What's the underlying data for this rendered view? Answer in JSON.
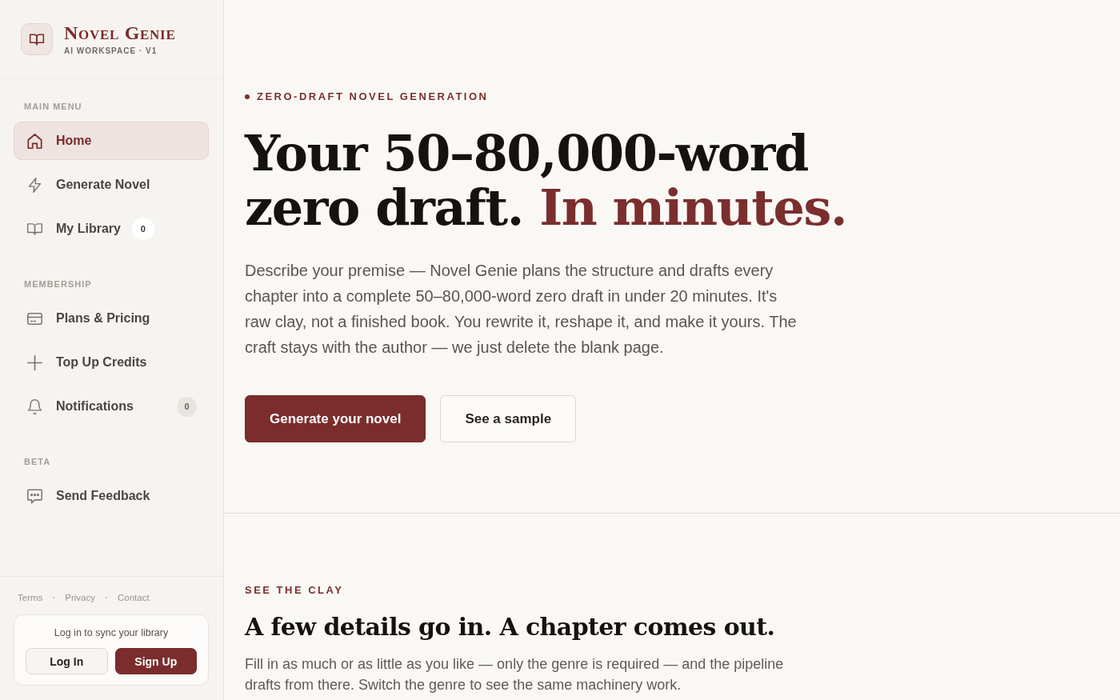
{
  "sidebar": {
    "brand": {
      "name": "Novel Genie",
      "tagline": "AI WORKSPACE · V1"
    },
    "sections": [
      {
        "heading": "MAIN MENU",
        "items": [
          {
            "label": "Home",
            "selected": true
          },
          {
            "label": "Generate Novel",
            "selected": false
          },
          {
            "label": "My Library",
            "selected": false,
            "badge": {
              "text": "0",
              "kind": "inline"
            }
          }
        ]
      },
      {
        "heading": "MEMBERSHIP",
        "items": [
          {
            "label": "Plans & Pricing",
            "selected": false
          },
          {
            "label": "Top Up Credits",
            "selected": false
          },
          {
            "label": "Notifications",
            "selected": false,
            "badge": {
              "text": "0",
              "kind": "trailing"
            }
          }
        ]
      },
      {
        "heading": "BETA",
        "items": [
          {
            "label": "Send Feedback",
            "selected": false
          }
        ]
      }
    ],
    "footer": {
      "links": [
        "Terms",
        "Privacy",
        "Contact"
      ],
      "prompt": "Log in to sync your library",
      "buttons": [
        {
          "label": "Log In",
          "kind": "secondary"
        },
        {
          "label": "Sign Up",
          "kind": "primary"
        }
      ]
    }
  },
  "hero": {
    "eyebrow": "ZERO-DRAFT NOVEL GENERATION",
    "headline": "Your 50–80,000-word zero draft.",
    "headline_accent": "In minutes.",
    "body": "Describe your premise — Novel Genie plans the structure and drafts every chapter into a complete 50–80,000-word zero draft in under 20 minutes. It's raw clay, not a finished book. You rewrite it, reshape it, and make it yours. The craft stays with the author — we just delete the blank page.",
    "buttons": [
      {
        "label": "Generate your novel",
        "kind": "primary"
      },
      {
        "label": "See a sample",
        "kind": "secondary"
      }
    ]
  },
  "section": {
    "eyebrow": "SEE THE CLAY",
    "heading": "A few details go in. A chapter comes out.",
    "body": "Fill in as much or as little as you like — only the genre is required — and the pipeline drafts from there. Switch the genre to see the same machinery work."
  }
}
